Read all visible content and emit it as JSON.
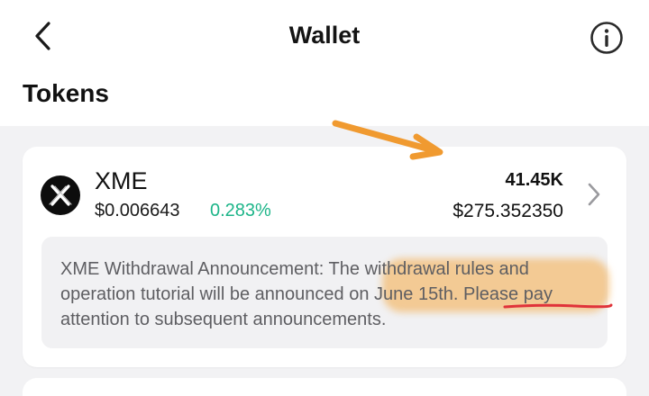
{
  "header": {
    "title": "Wallet"
  },
  "section": {
    "title": "Tokens"
  },
  "token": {
    "symbol": "XME",
    "price": "$0.006643",
    "change": "0.283%",
    "balance": "41.45K",
    "value": "$275.352350"
  },
  "announcement": {
    "text": "XME Withdrawal Announcement: The withdrawal rules and operation tutorial will be announced on June 15th. Please pay attention to subsequent announcements."
  },
  "colors": {
    "change_positive": "#1db589",
    "highlight": "#f4aa46",
    "arrow": "#f09a30",
    "underline": "#e0333a"
  },
  "icons": {
    "back": "chevron-left-icon",
    "info": "info-icon",
    "token_logo": "xme-logo",
    "row_chevron": "chevron-right-icon"
  }
}
